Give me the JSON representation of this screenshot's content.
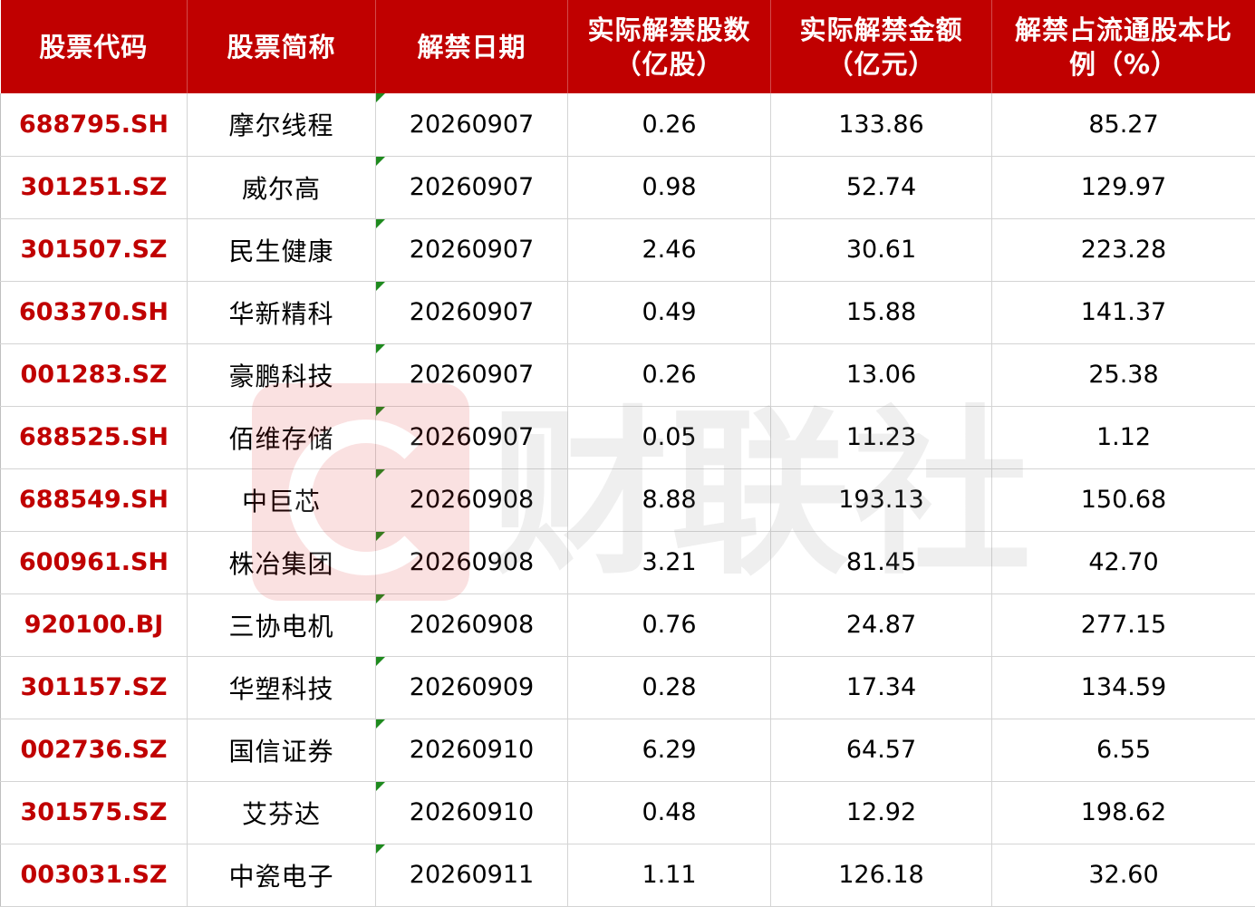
{
  "table": {
    "headers": [
      {
        "lines": [
          "股票代码"
        ]
      },
      {
        "lines": [
          "股票简称"
        ]
      },
      {
        "lines": [
          "解禁日期"
        ]
      },
      {
        "lines": [
          "实际解禁股数",
          "（亿股）"
        ]
      },
      {
        "lines": [
          "实际解禁金额",
          "（亿元）"
        ]
      },
      {
        "lines": [
          "解禁占流通股本比",
          "例（%）"
        ]
      }
    ],
    "rows": [
      {
        "code": "688795.SH",
        "name": "摩尔线程",
        "date": "20260907",
        "shares": "0.26",
        "amount": "133.86",
        "ratio": "85.27"
      },
      {
        "code": "301251.SZ",
        "name": "威尔高",
        "date": "20260907",
        "shares": "0.98",
        "amount": "52.74",
        "ratio": "129.97"
      },
      {
        "code": "301507.SZ",
        "name": "民生健康",
        "date": "20260907",
        "shares": "2.46",
        "amount": "30.61",
        "ratio": "223.28"
      },
      {
        "code": "603370.SH",
        "name": "华新精科",
        "date": "20260907",
        "shares": "0.49",
        "amount": "15.88",
        "ratio": "141.37"
      },
      {
        "code": "001283.SZ",
        "name": "豪鹏科技",
        "date": "20260907",
        "shares": "0.26",
        "amount": "13.06",
        "ratio": "25.38"
      },
      {
        "code": "688525.SH",
        "name": "佰维存储",
        "date": "20260907",
        "shares": "0.05",
        "amount": "11.23",
        "ratio": "1.12"
      },
      {
        "code": "688549.SH",
        "name": "中巨芯",
        "date": "20260908",
        "shares": "8.88",
        "amount": "193.13",
        "ratio": "150.68"
      },
      {
        "code": "600961.SH",
        "name": "株冶集团",
        "date": "20260908",
        "shares": "3.21",
        "amount": "81.45",
        "ratio": "42.70"
      },
      {
        "code": "920100.BJ",
        "name": "三协电机",
        "date": "20260908",
        "shares": "0.76",
        "amount": "24.87",
        "ratio": "277.15"
      },
      {
        "code": "301157.SZ",
        "name": "华塑科技",
        "date": "20260909",
        "shares": "0.28",
        "amount": "17.34",
        "ratio": "134.59"
      },
      {
        "code": "002736.SZ",
        "name": "国信证券",
        "date": "20260910",
        "shares": "6.29",
        "amount": "64.57",
        "ratio": "6.55"
      },
      {
        "code": "301575.SZ",
        "name": "艾芬达",
        "date": "20260910",
        "shares": "0.48",
        "amount": "12.92",
        "ratio": "198.62"
      },
      {
        "code": "003031.SZ",
        "name": "中瓷电子",
        "date": "20260911",
        "shares": "1.11",
        "amount": "126.18",
        "ratio": "32.60"
      }
    ]
  },
  "watermark": {
    "text": "财联社",
    "icon": "cls-logo-icon"
  },
  "colors": {
    "header_bg": "#c00000",
    "header_text": "#ffffff",
    "code_text": "#c00000",
    "cell_text": "#000000",
    "flag": "#1e8a1e",
    "grid_line": "#d4d4d4"
  }
}
